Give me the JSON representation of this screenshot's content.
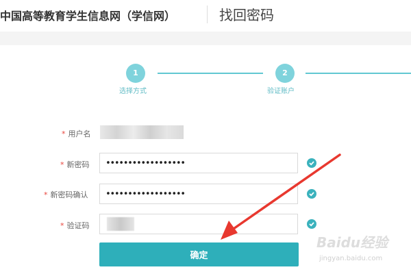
{
  "header": {
    "site_title": "中国高等教育学生信息网（学信网）",
    "page_title": "找回密码"
  },
  "steps": [
    {
      "number": "1",
      "label": "选择方式"
    },
    {
      "number": "2",
      "label": "验证账户"
    }
  ],
  "form": {
    "username_label": "用户名",
    "new_password_label": "新密码",
    "new_password_value": "••••••••••••••••••",
    "confirm_password_label": "新密码确认",
    "confirm_password_value": "••••••••••••••••••",
    "captcha_label": "验证码",
    "required_mark": "*",
    "submit_label": "确定"
  },
  "colors": {
    "accent": "#2eafba",
    "step_dot": "#7fd3dc",
    "required": "#e8453c",
    "arrow": "#e8382f"
  },
  "watermark": {
    "logo": "Baidu经验",
    "url": "jingyan.baidu.com"
  }
}
